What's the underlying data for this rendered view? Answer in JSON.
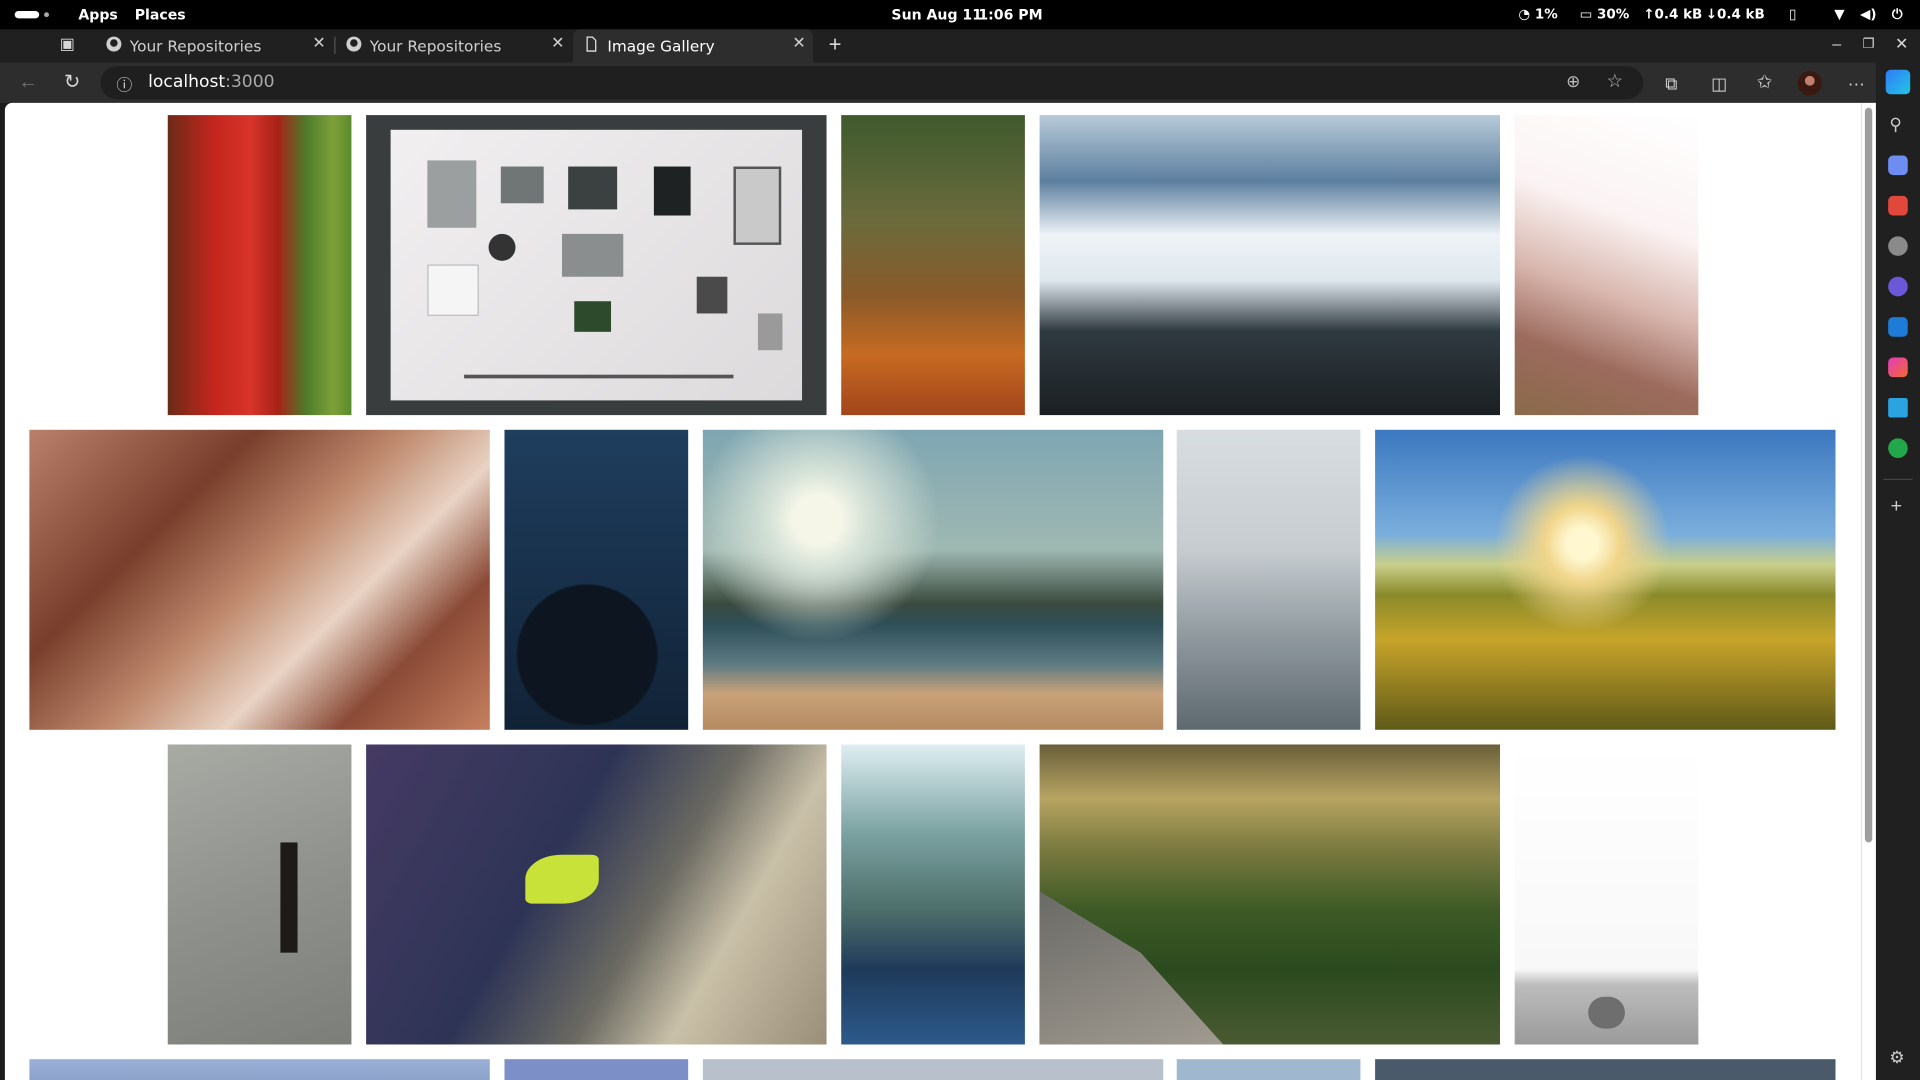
{
  "system_bar": {
    "apps_label": "Apps",
    "places_label": "Places",
    "date": "Sun Aug 11",
    "time": "1:06 PM",
    "cpu": "1%",
    "memory": "30%",
    "upload": "0.4 kB",
    "download": "0.4 kB"
  },
  "browser": {
    "tabs": [
      {
        "label": "Your Repositories",
        "icon": "github-icon"
      },
      {
        "label": "Your Repositories",
        "icon": "github-icon"
      },
      {
        "label": "Image Gallery",
        "icon": "page-icon"
      }
    ],
    "url_host": "localhost",
    "url_port": ":3000"
  }
}
